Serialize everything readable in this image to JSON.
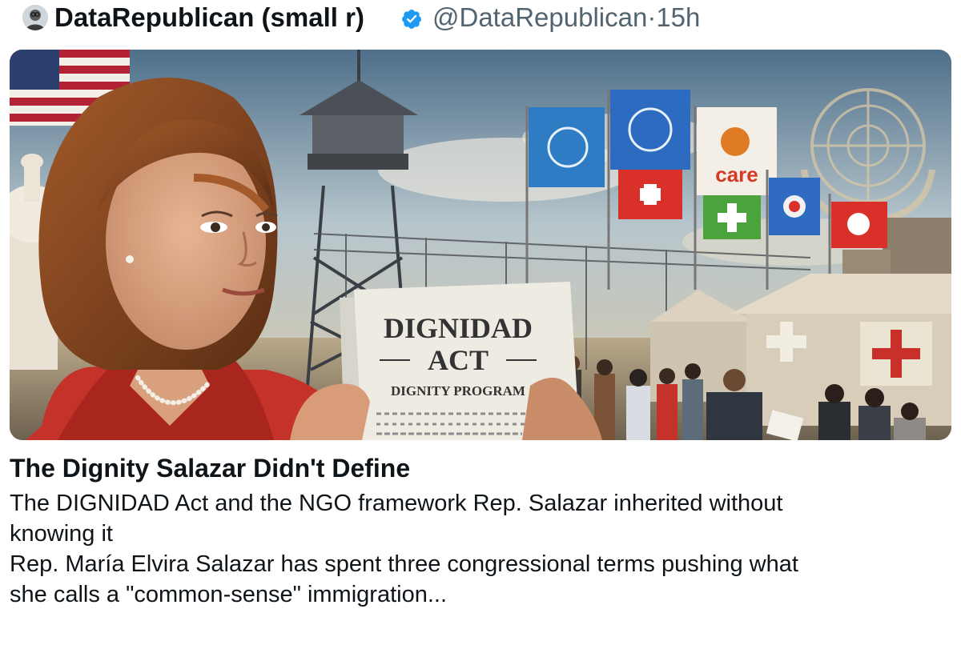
{
  "post": {
    "author_name": "DataRepublican (small r)",
    "handle": "@DataRepublican",
    "separator": "·",
    "time": "15h",
    "verified_icon": "verified-badge-icon",
    "accent_color": "#1d9bf0"
  },
  "card": {
    "image": {
      "document_title_line1": "DIGNIDAD",
      "document_title_line2": "ACT",
      "document_subtitle": "DIGNITY PROGRAM",
      "flag_label": "care"
    },
    "title": "The Dignity Salazar Didn't Define",
    "description_lines": [
      "The DIGNIDAD Act and the NGO framework Rep. Salazar inherited without",
      "knowing it",
      "Rep. María Elvira Salazar has spent three congressional terms pushing what",
      "she calls a \"common-sense\" immigration..."
    ]
  }
}
